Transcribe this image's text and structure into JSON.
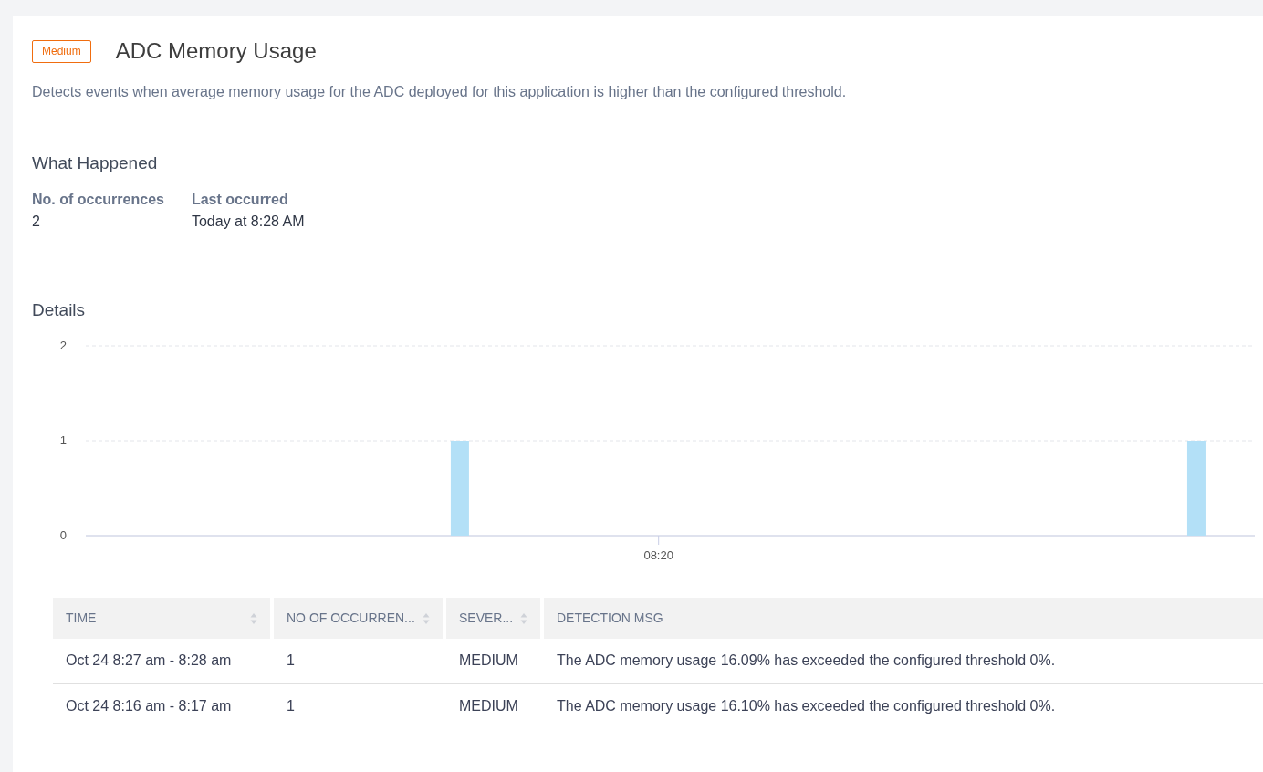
{
  "header": {
    "severity": "Medium",
    "title": "ADC Memory Usage",
    "description": "Detects events when average memory usage for the ADC deployed for this application is higher than the configured threshold."
  },
  "what_happened": {
    "title": "What Happened",
    "stats": [
      {
        "label": "No. of occurrences",
        "value": "2"
      },
      {
        "label": "Last occurred",
        "value": "Today at 8:28 AM"
      }
    ]
  },
  "details": {
    "title": "Details",
    "chart_data": {
      "type": "bar",
      "series": [
        {
          "color": "#b3e0f7",
          "values": [
            1,
            1
          ]
        }
      ],
      "ylim": [
        0,
        2
      ],
      "yticks": [
        {
          "value": 0,
          "label": "0"
        },
        {
          "value": 1,
          "label": "1"
        },
        {
          "value": 2,
          "label": "2"
        }
      ],
      "annotations": [
        "08:20"
      ]
    },
    "table": {
      "columns": [
        {
          "label": "TIME",
          "sortable": true
        },
        {
          "label": "NO OF OCCURREN...",
          "sortable": true
        },
        {
          "label": "SEVER...",
          "sortable": true
        },
        {
          "label": "DETECTION MSG",
          "sortable": false
        }
      ],
      "rows": [
        [
          "Oct 24 8:27 am - 8:28 am",
          "1",
          "MEDIUM",
          "The ADC memory usage 16.09% has exceeded the configured threshold 0%."
        ],
        [
          "Oct 24 8:16 am - 8:17 am",
          "1",
          "MEDIUM",
          "The ADC memory usage 16.10% has exceeded the configured threshold 0%."
        ]
      ]
    }
  }
}
